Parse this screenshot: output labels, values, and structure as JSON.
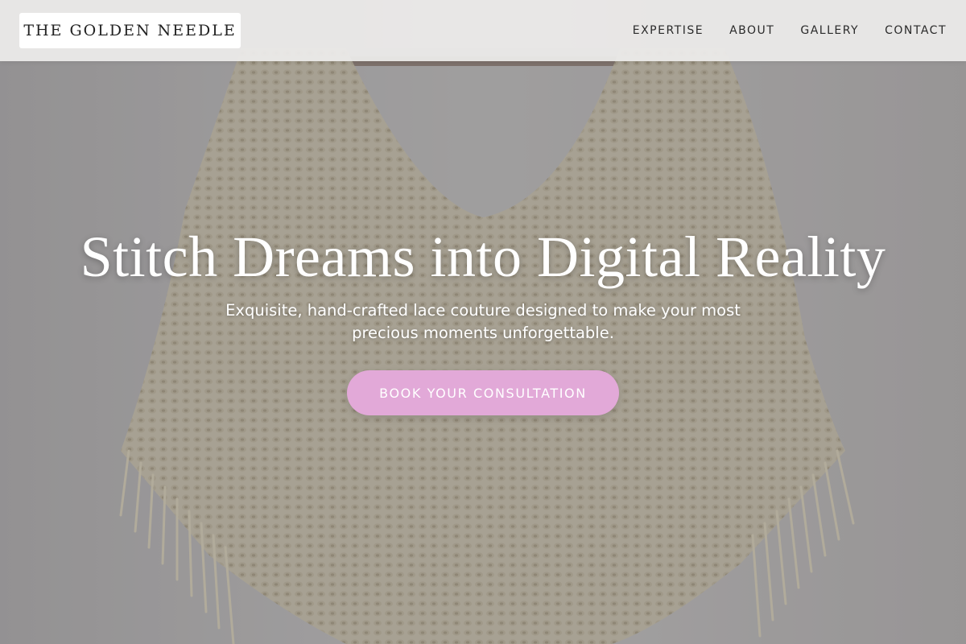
{
  "brand": {
    "name": "THE GOLDEN NEEDLE"
  },
  "nav": {
    "items": [
      {
        "label": "EXPERTISE"
      },
      {
        "label": "ABOUT"
      },
      {
        "label": "GALLERY"
      },
      {
        "label": "CONTACT"
      }
    ]
  },
  "hero": {
    "title": "Stitch Dreams into Digital Reality",
    "subtitle": "Exquisite, hand-crafted lace couture designed to make your most precious moments unforgettable.",
    "cta_label": "BOOK YOUR CONSULTATION",
    "image_subject": "cream knitted fringe poncho on hanger"
  },
  "colors": {
    "cta_background": "#e2a9d8",
    "header_background": "#ecebea",
    "hero_text": "#ffffff"
  }
}
